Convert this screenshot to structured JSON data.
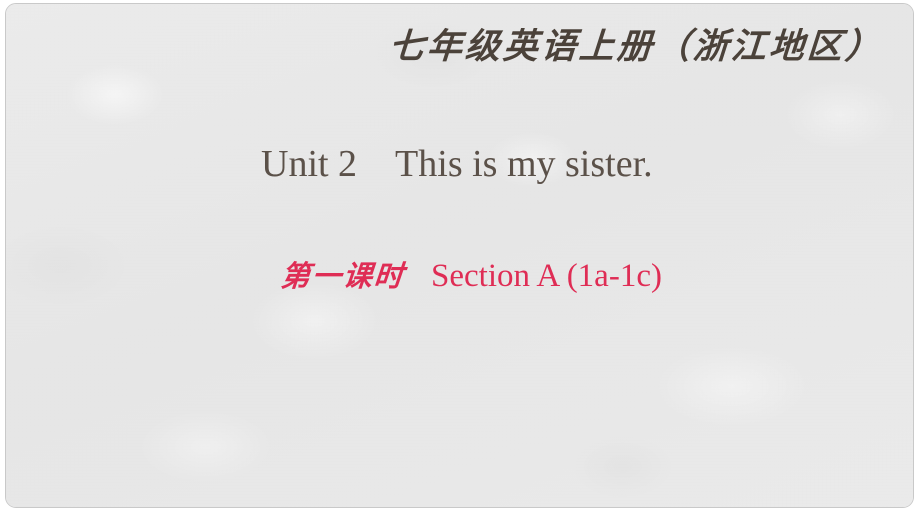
{
  "slide": {
    "course_title": "七年级英语上册（浙江地区）",
    "unit_line": "Unit 2　This is my sister.",
    "lesson_cn": "第一课时",
    "lesson_en": "Section A (1a-1c)",
    "colors": {
      "background": "#e8e8e8",
      "frame_border": "#c9c9c9",
      "course_title": "#4b423a",
      "unit_text": "#5b5149",
      "lesson_text": "#df2d55"
    }
  }
}
